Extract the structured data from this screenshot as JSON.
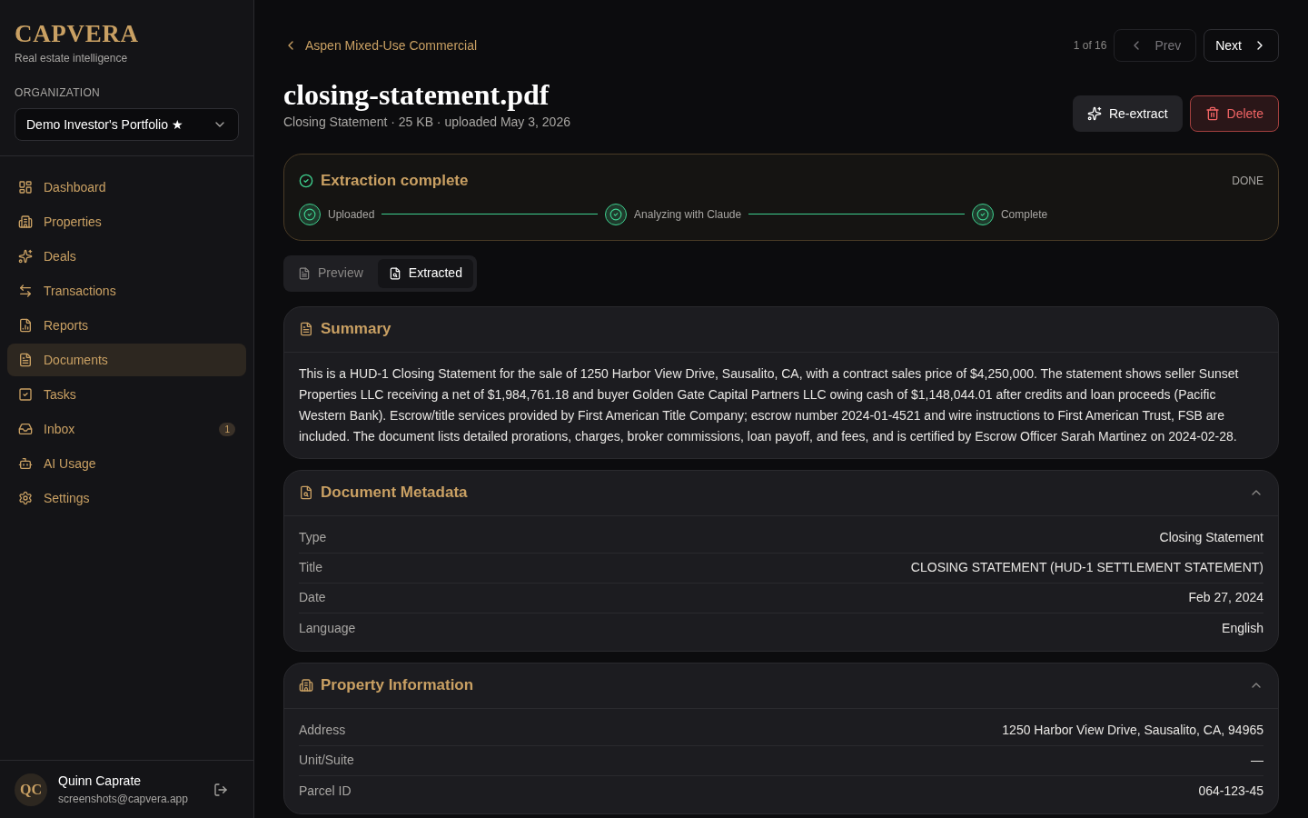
{
  "brand": {
    "name": "CAPVERA",
    "tagline": "Real estate intelligence"
  },
  "organization": {
    "label": "ORGANIZATION",
    "value": "Demo Investor's Portfolio ★"
  },
  "nav": [
    {
      "label": "Dashboard",
      "selected": false
    },
    {
      "label": "Properties",
      "selected": false
    },
    {
      "label": "Deals",
      "selected": false
    },
    {
      "label": "Transactions",
      "selected": false
    },
    {
      "label": "Reports",
      "selected": false
    },
    {
      "label": "Documents",
      "selected": true
    },
    {
      "label": "Tasks",
      "selected": false
    },
    {
      "label": "Inbox",
      "selected": false,
      "badge": "1"
    },
    {
      "label": "AI Usage",
      "selected": false
    },
    {
      "label": "Settings",
      "selected": false
    }
  ],
  "user": {
    "initials": "QC",
    "name": "Quinn Caprate",
    "email": "screenshots@capvera.app"
  },
  "breadcrumb": "Aspen Mixed-Use Commercial",
  "pager": {
    "position": "1 of 16",
    "prev": "Prev",
    "next": "Next",
    "prev_disabled": true
  },
  "document": {
    "title": "closing-statement.pdf",
    "meta": "Closing Statement · 25 KB · uploaded May 3, 2026"
  },
  "actions": [
    {
      "label": "Re-extract",
      "kind": "neutral"
    },
    {
      "label": "Delete",
      "kind": "danger"
    }
  ],
  "extraction": {
    "title": "Extraction complete",
    "status": "DONE",
    "steps": [
      {
        "label": "Uploaded",
        "done": true
      },
      {
        "label": "Analyzing with Claude",
        "done": true
      },
      {
        "label": "Complete",
        "done": true
      }
    ]
  },
  "tabs": [
    {
      "label": "Preview",
      "selected": false
    },
    {
      "label": "Extracted",
      "selected": true
    }
  ],
  "sections": [
    {
      "kind": "text",
      "title": "Summary",
      "text": "This is a HUD-1 Closing Statement for the sale of 1250 Harbor View Drive, Sausalito, CA, with a contract sales price of $4,250,000. The statement shows seller Sunset Properties LLC receiving a net of $1,984,761.18 and buyer Golden Gate Capital Partners LLC owing cash of $1,148,044.01 after credits and loan proceeds (Pacific Western Bank). Escrow/title services provided by First American Title Company; escrow number 2024-01-4521 and wire instructions to First American Trust, FSB are included. The document lists detailed prorations, charges, broker commissions, loan payoff, and fees, and is certified by Escrow Officer Sarah Martinez on 2024-02-28."
    },
    {
      "kind": "fields",
      "title": "Document Metadata",
      "expanded": true,
      "fields": [
        {
          "label": "Type",
          "value": "Closing Statement"
        },
        {
          "label": "Title",
          "value": "CLOSING STATEMENT (HUD-1 SETTLEMENT STATEMENT)"
        },
        {
          "label": "Date",
          "value": "Feb 27, 2024"
        },
        {
          "label": "Language",
          "value": "English"
        }
      ]
    },
    {
      "kind": "fields",
      "title": "Property Information",
      "expanded": true,
      "fields": [
        {
          "label": "Address",
          "value": "1250 Harbor View Drive, Sausalito, CA, 94965"
        },
        {
          "label": "Unit/Suite",
          "value": "—"
        },
        {
          "label": "Parcel ID",
          "value": "064-123-45"
        }
      ]
    }
  ]
}
